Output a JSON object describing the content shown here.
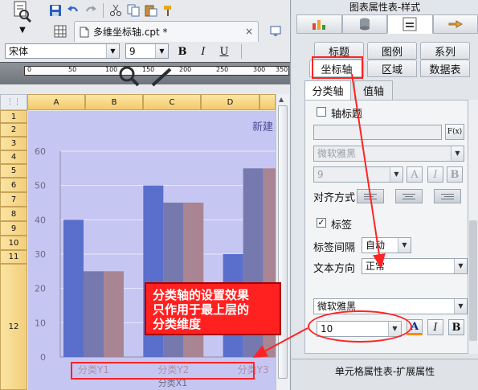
{
  "editor": {
    "doc_tab_title": "多维坐标轴.cpt *",
    "font_name": "宋体",
    "font_size": "9",
    "bold_label": "B",
    "italic_label": "I",
    "underline_label": "U",
    "ruler_labels": [
      "0",
      "50",
      "100",
      "150",
      "200",
      "250",
      "300",
      "350"
    ]
  },
  "grid": {
    "columns": [
      "A",
      "B",
      "C",
      "D"
    ],
    "rows": [
      "1",
      "2",
      "3",
      "4",
      "5",
      "6",
      "7",
      "8",
      "9",
      "10",
      "11",
      "12"
    ]
  },
  "chart_data": {
    "type": "bar",
    "title": "新建",
    "categories": [
      "分类Y1",
      "分类Y2",
      "分类Y3"
    ],
    "outer_category": "分类X1",
    "series": [
      {
        "values": [
          40,
          50,
          30
        ],
        "color": "#5a6fcc"
      },
      {
        "values": [
          25,
          45,
          55
        ],
        "color": "#7679ae"
      },
      {
        "values": [
          25,
          45,
          55
        ],
        "color": "#a98593"
      }
    ],
    "ylim": [
      0,
      60
    ],
    "yticks": [
      0,
      10,
      20,
      30,
      40,
      50,
      60
    ],
    "grid": true
  },
  "callout": {
    "lines": [
      "分类轴的设置效果",
      "只作用于最上层的",
      "分类维度"
    ]
  },
  "panel": {
    "title": "图表属性表-样式",
    "tabs_row1": [
      "标题",
      "图例",
      "系列"
    ],
    "tabs_row2": [
      "坐标轴",
      "区域",
      "数据表"
    ],
    "sub_tabs": [
      "分类轴",
      "值轴"
    ],
    "axis_title_label": "轴标题",
    "axis_font": "微软雅黑",
    "axis_font_size": "9",
    "fx_label": "F(x)",
    "align_label": "对齐方式",
    "label_check": "标签",
    "label_interval_label": "标签间隔",
    "label_interval_value": "自动",
    "text_direction_label": "文本方向",
    "text_direction_value": "正常",
    "label_font": "微软雅黑",
    "label_font_size": "10",
    "bold_label": "B",
    "italic_label": "I",
    "font_color_label": "A"
  },
  "bottom_panel": {
    "title": "单元格属性表-扩展属性"
  }
}
